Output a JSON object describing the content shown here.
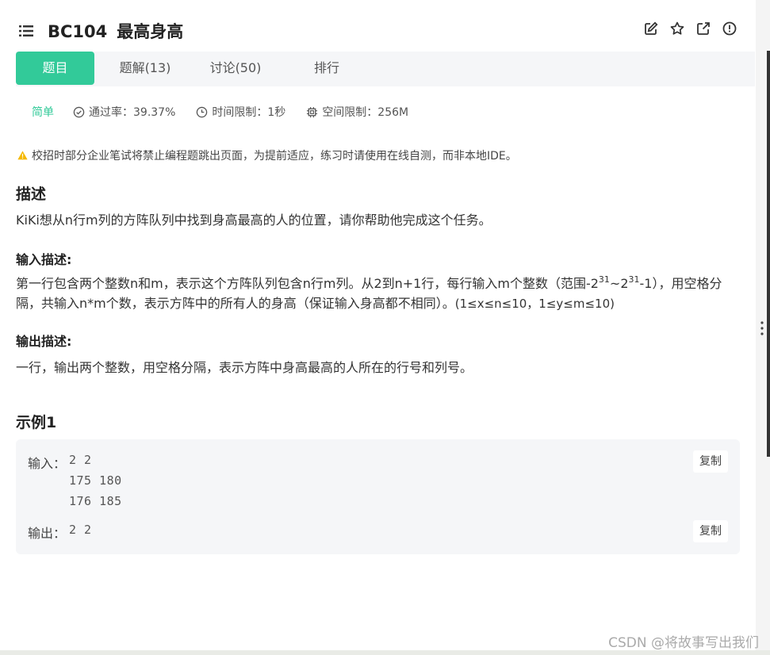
{
  "header": {
    "code": "BC104",
    "name": "最高身高",
    "icons": [
      "list-icon",
      "edit-icon",
      "star-icon",
      "external-link-icon",
      "info-icon"
    ]
  },
  "tabs": [
    {
      "label": "题目",
      "active": true
    },
    {
      "label": "题解(13)",
      "active": false
    },
    {
      "label": "讨论(50)",
      "active": false
    },
    {
      "label": "排行",
      "active": false
    }
  ],
  "meta": {
    "difficulty": "简单",
    "pass_rate": "通过率：39.37%",
    "time_limit": "时间限制：1秒",
    "space_limit": "空间限制：256M"
  },
  "notice": "校招时部分企业笔试将禁止编程题跳出页面，为提前适应，练习时请使用在线自测，而非本地IDE。",
  "description": {
    "heading": "描述",
    "text": "KiKi想从n行m列的方阵队列中找到身高最高的人的位置，请你帮助他完成这个任务。"
  },
  "input_desc": {
    "heading": "输入描述:",
    "text_part1": "第一行包含两个整数n和m，表示这个方阵队列包含n行m列。从2到n+1行，每行输入m个整数（范围-2",
    "sup1": "31",
    "mid": "~2",
    "sup2": "31",
    "text_part2": "-1），用空格分隔，共输入n*m个数，表示方阵中的所有人的身高（保证输入身高都不相同）。",
    "range": "(1≤x≤n≤10，1≤y≤m≤10)"
  },
  "output_desc": {
    "heading": "输出描述:",
    "text": "一行，输出两个整数，用空格分隔，表示方阵中身高最高的人所在的行号和列号。"
  },
  "example": {
    "heading": "示例1",
    "input_label": "输入：",
    "input_value": "2 2\n175 180\n176 185",
    "output_label": "输出：",
    "output_value": "2 2",
    "copy_label": "复制"
  },
  "watermark": "CSDN @将故事写出我们",
  "colors": {
    "accent": "#32ca99",
    "tab_bg": "#f5f6f8",
    "warning": "#f5b800"
  }
}
